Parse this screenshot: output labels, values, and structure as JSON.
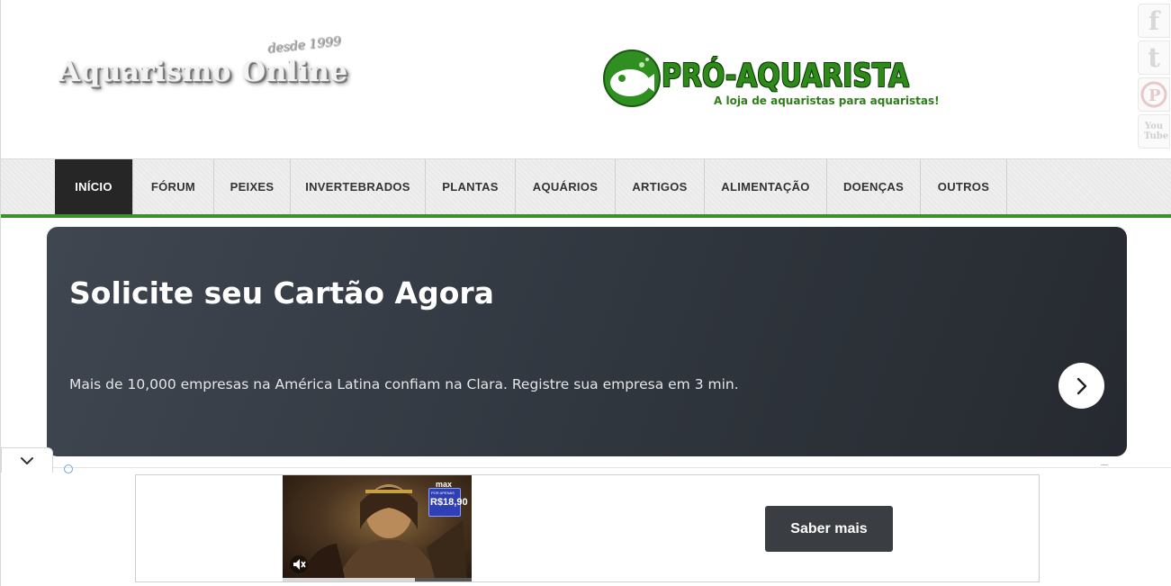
{
  "header": {
    "site_title": "Aquarismo Online",
    "site_tagline": "desde 1999",
    "brand_name": "PRÓ-AQUARISTA",
    "brand_slogan": "A loja de aquaristas para aquaristas!"
  },
  "social": [
    {
      "name": "facebook-icon",
      "glyph": "f"
    },
    {
      "name": "twitter-icon",
      "glyph": "t"
    },
    {
      "name": "pinterest-icon",
      "glyph": "P"
    },
    {
      "name": "youtube-icon",
      "glyph": "You Tube"
    }
  ],
  "nav": {
    "items": [
      {
        "label": "INÍCIO",
        "active": true
      },
      {
        "label": "FÓRUM"
      },
      {
        "label": "PEIXES"
      },
      {
        "label": "INVERTEBRADOS"
      },
      {
        "label": "PLANTAS"
      },
      {
        "label": "AQUÁRIOS"
      },
      {
        "label": "ARTIGOS"
      },
      {
        "label": "ALIMENTAÇÃO"
      },
      {
        "label": "DOENÇAS"
      },
      {
        "label": "OUTROS"
      }
    ]
  },
  "ad_banner": {
    "title": "Solicite seu Cartão Agora",
    "text": "Mais de 10,000 empresas na América Latina confiam na Clara. Registre sua empresa em 3 min."
  },
  "video_ad": {
    "brand": "max",
    "promo_label": "POR APENAS",
    "promo_price": "R$18,90",
    "cta_label": "Saber mais",
    "progress": 0.7
  },
  "colors": {
    "accent_green": "#3f8f2a",
    "nav_active_bg": "#262626",
    "banner_bg": "#30363e"
  }
}
